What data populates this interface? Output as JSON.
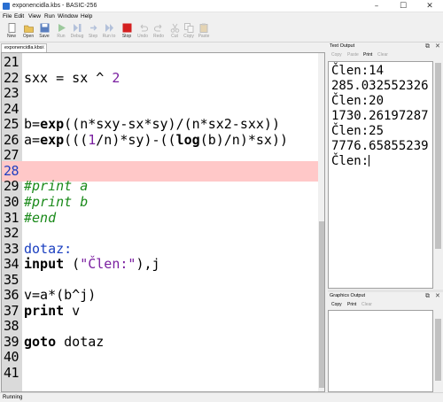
{
  "window": {
    "title": "exponencidla.kbs - BASIC-256",
    "min_glyph": "–",
    "max_glyph": "☐",
    "close_glyph": "✕"
  },
  "menu": [
    "File",
    "Edit",
    "View",
    "Run",
    "Window",
    "Help"
  ],
  "toolbar": [
    {
      "label": "New",
      "icon": "new-file-icon",
      "color": "#ffffff",
      "enabled": true
    },
    {
      "label": "Open",
      "icon": "open-folder-icon",
      "color": "#e8c15a",
      "enabled": true
    },
    {
      "label": "Save",
      "icon": "save-disk-icon",
      "color": "#5a7fbf",
      "enabled": true
    },
    {
      "label": "Run",
      "icon": "run-play-icon",
      "color": "#3a9a3a",
      "enabled": false
    },
    {
      "label": "Debug",
      "icon": "debug-icon",
      "color": "#6a8ac0",
      "enabled": false
    },
    {
      "label": "Step",
      "icon": "step-icon",
      "color": "#6a8ac0",
      "enabled": false
    },
    {
      "label": "Run to",
      "icon": "run-to-icon",
      "color": "#6a8ac0",
      "enabled": false
    },
    {
      "label": "Stop",
      "icon": "stop-icon",
      "color": "#d42020",
      "enabled": true
    },
    {
      "label": "Undo",
      "icon": "undo-icon",
      "color": "#888888",
      "enabled": false
    },
    {
      "label": "Redo",
      "icon": "redo-icon",
      "color": "#888888",
      "enabled": false
    },
    {
      "label": "Cut",
      "icon": "cut-scissors-icon",
      "color": "#888888",
      "enabled": false
    },
    {
      "label": "Copy",
      "icon": "copy-icon",
      "color": "#888888",
      "enabled": false
    },
    {
      "label": "Paste",
      "icon": "paste-icon",
      "color": "#888888",
      "enabled": false
    }
  ],
  "editor": {
    "tab_label": "exponencidla.kbs",
    "tab_close": "x",
    "lines": [
      {
        "n": "21",
        "code": ""
      },
      {
        "n": "22",
        "code": "sxx = sx ^ 2"
      },
      {
        "n": "23",
        "code": ""
      },
      {
        "n": "24",
        "code": ""
      },
      {
        "n": "25",
        "code": "b=exp((n*sxy-sx*sy)/(n*sx2-sxx))"
      },
      {
        "n": "26",
        "code": "a=exp(((1/n)*sy)-((log(b)/n)*sx))"
      },
      {
        "n": "27",
        "code": ""
      },
      {
        "n": "28",
        "code": "",
        "highlight": true
      },
      {
        "n": "29",
        "code": "#print a"
      },
      {
        "n": "30",
        "code": "#print b"
      },
      {
        "n": "31",
        "code": "#end"
      },
      {
        "n": "32",
        "code": ""
      },
      {
        "n": "33",
        "code": "dotaz:"
      },
      {
        "n": "34",
        "code": "input (\"Člen:\"),j"
      },
      {
        "n": "35",
        "code": ""
      },
      {
        "n": "36",
        "code": "v=a*(b^j)"
      },
      {
        "n": "37",
        "code": "print v"
      },
      {
        "n": "38",
        "code": ""
      },
      {
        "n": "39",
        "code": "goto dotaz"
      },
      {
        "n": "40",
        "code": ""
      },
      {
        "n": "41",
        "code": ""
      }
    ]
  },
  "text_output": {
    "title": "Text Output",
    "buttons": [
      {
        "label": "Copy",
        "enabled": false
      },
      {
        "label": "Paste",
        "enabled": false
      },
      {
        "label": "Print",
        "enabled": true
      },
      {
        "label": "Clear",
        "enabled": false
      }
    ],
    "lines": [
      "Člen:14",
      "285.032552326",
      "Člen:20",
      "1730.26197287",
      "Člen:25",
      "7776.65855239",
      "Člen:"
    ]
  },
  "graphics_output": {
    "title": "Graphics Output",
    "buttons": [
      {
        "label": "Copy",
        "enabled": true
      },
      {
        "label": "Print",
        "enabled": true
      },
      {
        "label": "Clear",
        "enabled": false
      }
    ]
  },
  "panel_controls": {
    "float": "⧉",
    "close": "✕"
  },
  "status": "Running"
}
